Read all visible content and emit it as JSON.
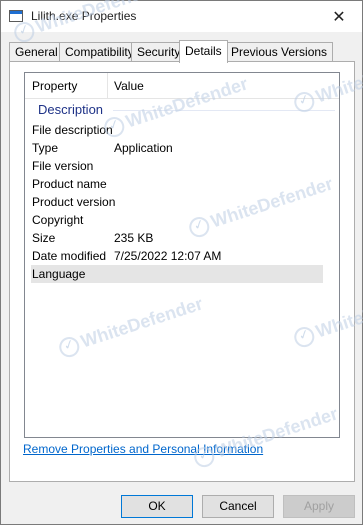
{
  "window": {
    "title": "Lilith.exe Properties",
    "close_glyph": "✕"
  },
  "tabs": [
    {
      "label": "General"
    },
    {
      "label": "Compatibility"
    },
    {
      "label": "Security"
    },
    {
      "label": "Details",
      "active": true
    },
    {
      "label": "Previous Versions"
    }
  ],
  "details": {
    "columns": {
      "property": "Property",
      "value": "Value"
    },
    "group": "Description",
    "rows": [
      {
        "name": "File description",
        "value": ""
      },
      {
        "name": "Type",
        "value": "Application"
      },
      {
        "name": "File version",
        "value": ""
      },
      {
        "name": "Product name",
        "value": ""
      },
      {
        "name": "Product version",
        "value": ""
      },
      {
        "name": "Copyright",
        "value": ""
      },
      {
        "name": "Size",
        "value": "235 KB"
      },
      {
        "name": "Date modified",
        "value": "7/25/2022 12:07 AM"
      },
      {
        "name": "Language",
        "value": "",
        "selected": true
      }
    ]
  },
  "link": {
    "remove_properties": "Remove Properties and Personal Information"
  },
  "buttons": {
    "ok": "OK",
    "cancel": "Cancel",
    "apply": "Apply"
  },
  "watermark": {
    "text": "WhiteDefender"
  },
  "colors": {
    "link": "#0066cc",
    "group_header": "#1e3287",
    "focus_border": "#0078d7"
  },
  "icons": {
    "app": "application-window-icon",
    "close": "close-icon",
    "watermark": "check-circle-icon"
  }
}
